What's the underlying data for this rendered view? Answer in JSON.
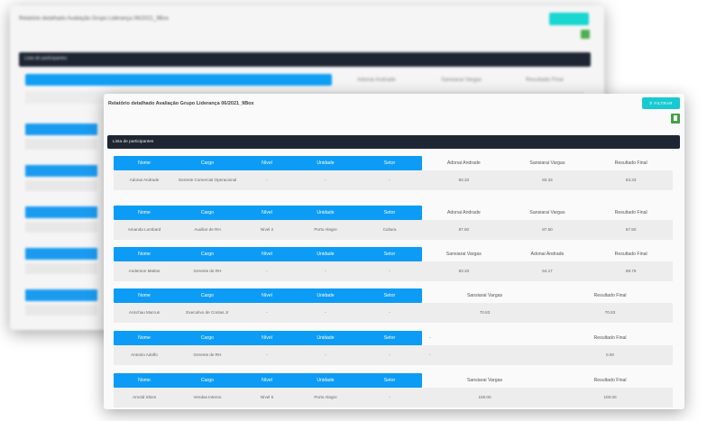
{
  "background_window": {
    "title": "Relatório detalhado Avaliação Grupo Liderança 06/2021_9Box",
    "list_label": "Lista de participantes",
    "header_cols": [
      "Nome",
      "Cargo",
      "Nível",
      "Unidade",
      "Setor"
    ],
    "extra_cols": [
      "Adonai Andrade",
      "Sansiarai Vargas",
      "Resultado Final"
    ]
  },
  "window": {
    "title": "Relatório detalhado Avaliação Grupo Liderança 06/2021_9Box",
    "filter_label": "FILTRAR",
    "doc_icon": "document-icon",
    "list_label": "Lista de participantes"
  },
  "base_headers": [
    "Nome",
    "Cargo",
    "Nível",
    "Unidade",
    "Setor"
  ],
  "sections": [
    {
      "extra_headers": [
        "Adonai Andrade",
        "Sansiarai Vargas",
        "Resultado Final"
      ],
      "row": {
        "nome": "Adonai Andrade",
        "cargo": "Gerente Comercial Operacional",
        "nivel": "-",
        "unidade": "-",
        "setor": "-",
        "values": [
          "83.33",
          "83.33",
          "83.33"
        ]
      }
    },
    {
      "extra_headers": [
        "Adonai Andrade",
        "Sansiarai Vargas",
        "Resultado Final"
      ],
      "row": {
        "nome": "Amanda Lombard",
        "cargo": "Auxiliar de RH",
        "nivel": "Nível 2",
        "unidade": "Porto Alegre",
        "setor": "Cultura",
        "values": [
          "87.50",
          "87.50",
          "87.50"
        ]
      }
    },
    {
      "extra_headers": [
        "Sansiarai Vargas",
        "Adonai Andrade",
        "Resultado Final"
      ],
      "row": {
        "nome": "Anderson Mattos",
        "cargo": "Gerente de RH",
        "nivel": "-",
        "unidade": "-",
        "setor": "-",
        "values": [
          "83.33",
          "54.17",
          "68.75"
        ]
      }
    },
    {
      "extra_headers": [
        "Sansiarai Vargas",
        "Resultado Final"
      ],
      "row": {
        "nome": "Anschau Marcus",
        "cargo": "Executivo de Contas Jr",
        "nivel": "-",
        "unidade": "-",
        "setor": "-",
        "values": [
          "70.83",
          "70.83"
        ]
      }
    },
    {
      "extra_headers": [
        "-",
        "Resultado Final"
      ],
      "row": {
        "nome": "Antonio Adolfo",
        "cargo": "Gerente de RH",
        "nivel": "-",
        "unidade": "-",
        "setor": "-",
        "values": [
          "-",
          "0.00"
        ]
      }
    },
    {
      "extra_headers": [
        "Sansiarai Vargas",
        "Resultado Final"
      ],
      "row": {
        "nome": "Arnold Shies",
        "cargo": "Vendas Interno",
        "nivel": "Nível 5",
        "unidade": "Porto Alegre",
        "setor": "-",
        "values": [
          "100.00",
          "100.00"
        ]
      }
    }
  ]
}
